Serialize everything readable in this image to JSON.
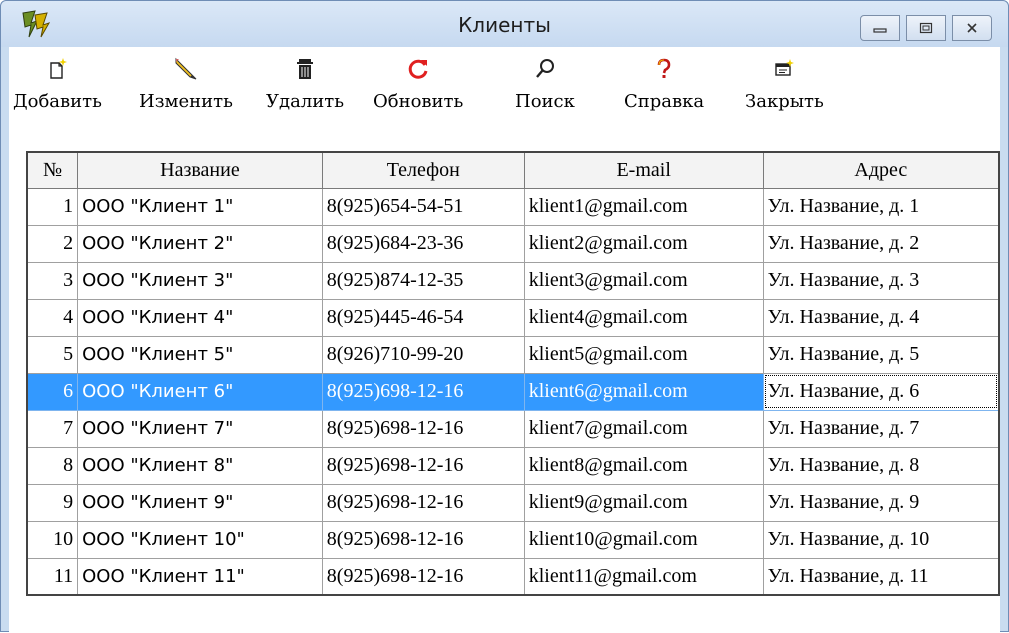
{
  "window": {
    "title": "Клиенты"
  },
  "toolbar": {
    "add": "Добавить",
    "edit": "Изменить",
    "delete": "Удалить",
    "refresh": "Обновить",
    "search": "Поиск",
    "help": "Справка",
    "close": "Закрыть"
  },
  "table": {
    "headers": [
      "№",
      "Название",
      "Телефон",
      "E-mail",
      "Адрес"
    ],
    "rows": [
      [
        "1",
        "ООО \"Клиент 1\"",
        "8(925)654-54-51",
        "klient1@gmail.com",
        "Ул. Название, д. 1"
      ],
      [
        "2",
        "ООО \"Клиент 2\"",
        "8(925)684-23-36",
        "klient2@gmail.com",
        "Ул. Название, д. 2"
      ],
      [
        "3",
        "ООО \"Клиент 3\"",
        "8(925)874-12-35",
        "klient3@gmail.com",
        "Ул. Название, д. 3"
      ],
      [
        "4",
        "ООО \"Клиент 4\"",
        "8(925)445-46-54",
        "klient4@gmail.com",
        "Ул. Название, д. 4"
      ],
      [
        "5",
        "ООО \"Клиент 5\"",
        "8(926)710-99-20",
        "klient5@gmail.com",
        "Ул. Название, д. 5"
      ],
      [
        "6",
        "ООО \"Клиент 6\"",
        "8(925)698-12-16",
        "klient6@gmail.com",
        "Ул. Название, д. 6"
      ],
      [
        "7",
        "ООО \"Клиент 7\"",
        "8(925)698-12-16",
        "klient7@gmail.com",
        "Ул. Название, д. 7"
      ],
      [
        "8",
        "ООО \"Клиент 8\"",
        "8(925)698-12-16",
        "klient8@gmail.com",
        "Ул. Название, д. 8"
      ],
      [
        "9",
        "ООО \"Клиент 9\"",
        "8(925)698-12-16",
        "klient9@gmail.com",
        "Ул. Название, д. 9"
      ],
      [
        "10",
        "ООО \"Клиент 10\"",
        "8(925)698-12-16",
        "klient10@gmail.com",
        "Ул. Название, д. 10"
      ],
      [
        "11",
        "ООО \"Клиент 11\"",
        "8(925)698-12-16",
        "klient11@gmail.com",
        "Ул. Название, д. 11"
      ]
    ],
    "selected_row": 6
  },
  "colors": {
    "selection": "#3399ff",
    "refresh_icon": "#e02020",
    "help_icon": "#e0a000"
  },
  "icons": {
    "app": "app-logo-icon",
    "add": "new-document-icon",
    "edit": "pencil-icon",
    "delete": "trash-icon",
    "refresh": "refresh-icon",
    "search": "magnifier-icon",
    "help": "question-icon",
    "close": "close-form-icon"
  }
}
